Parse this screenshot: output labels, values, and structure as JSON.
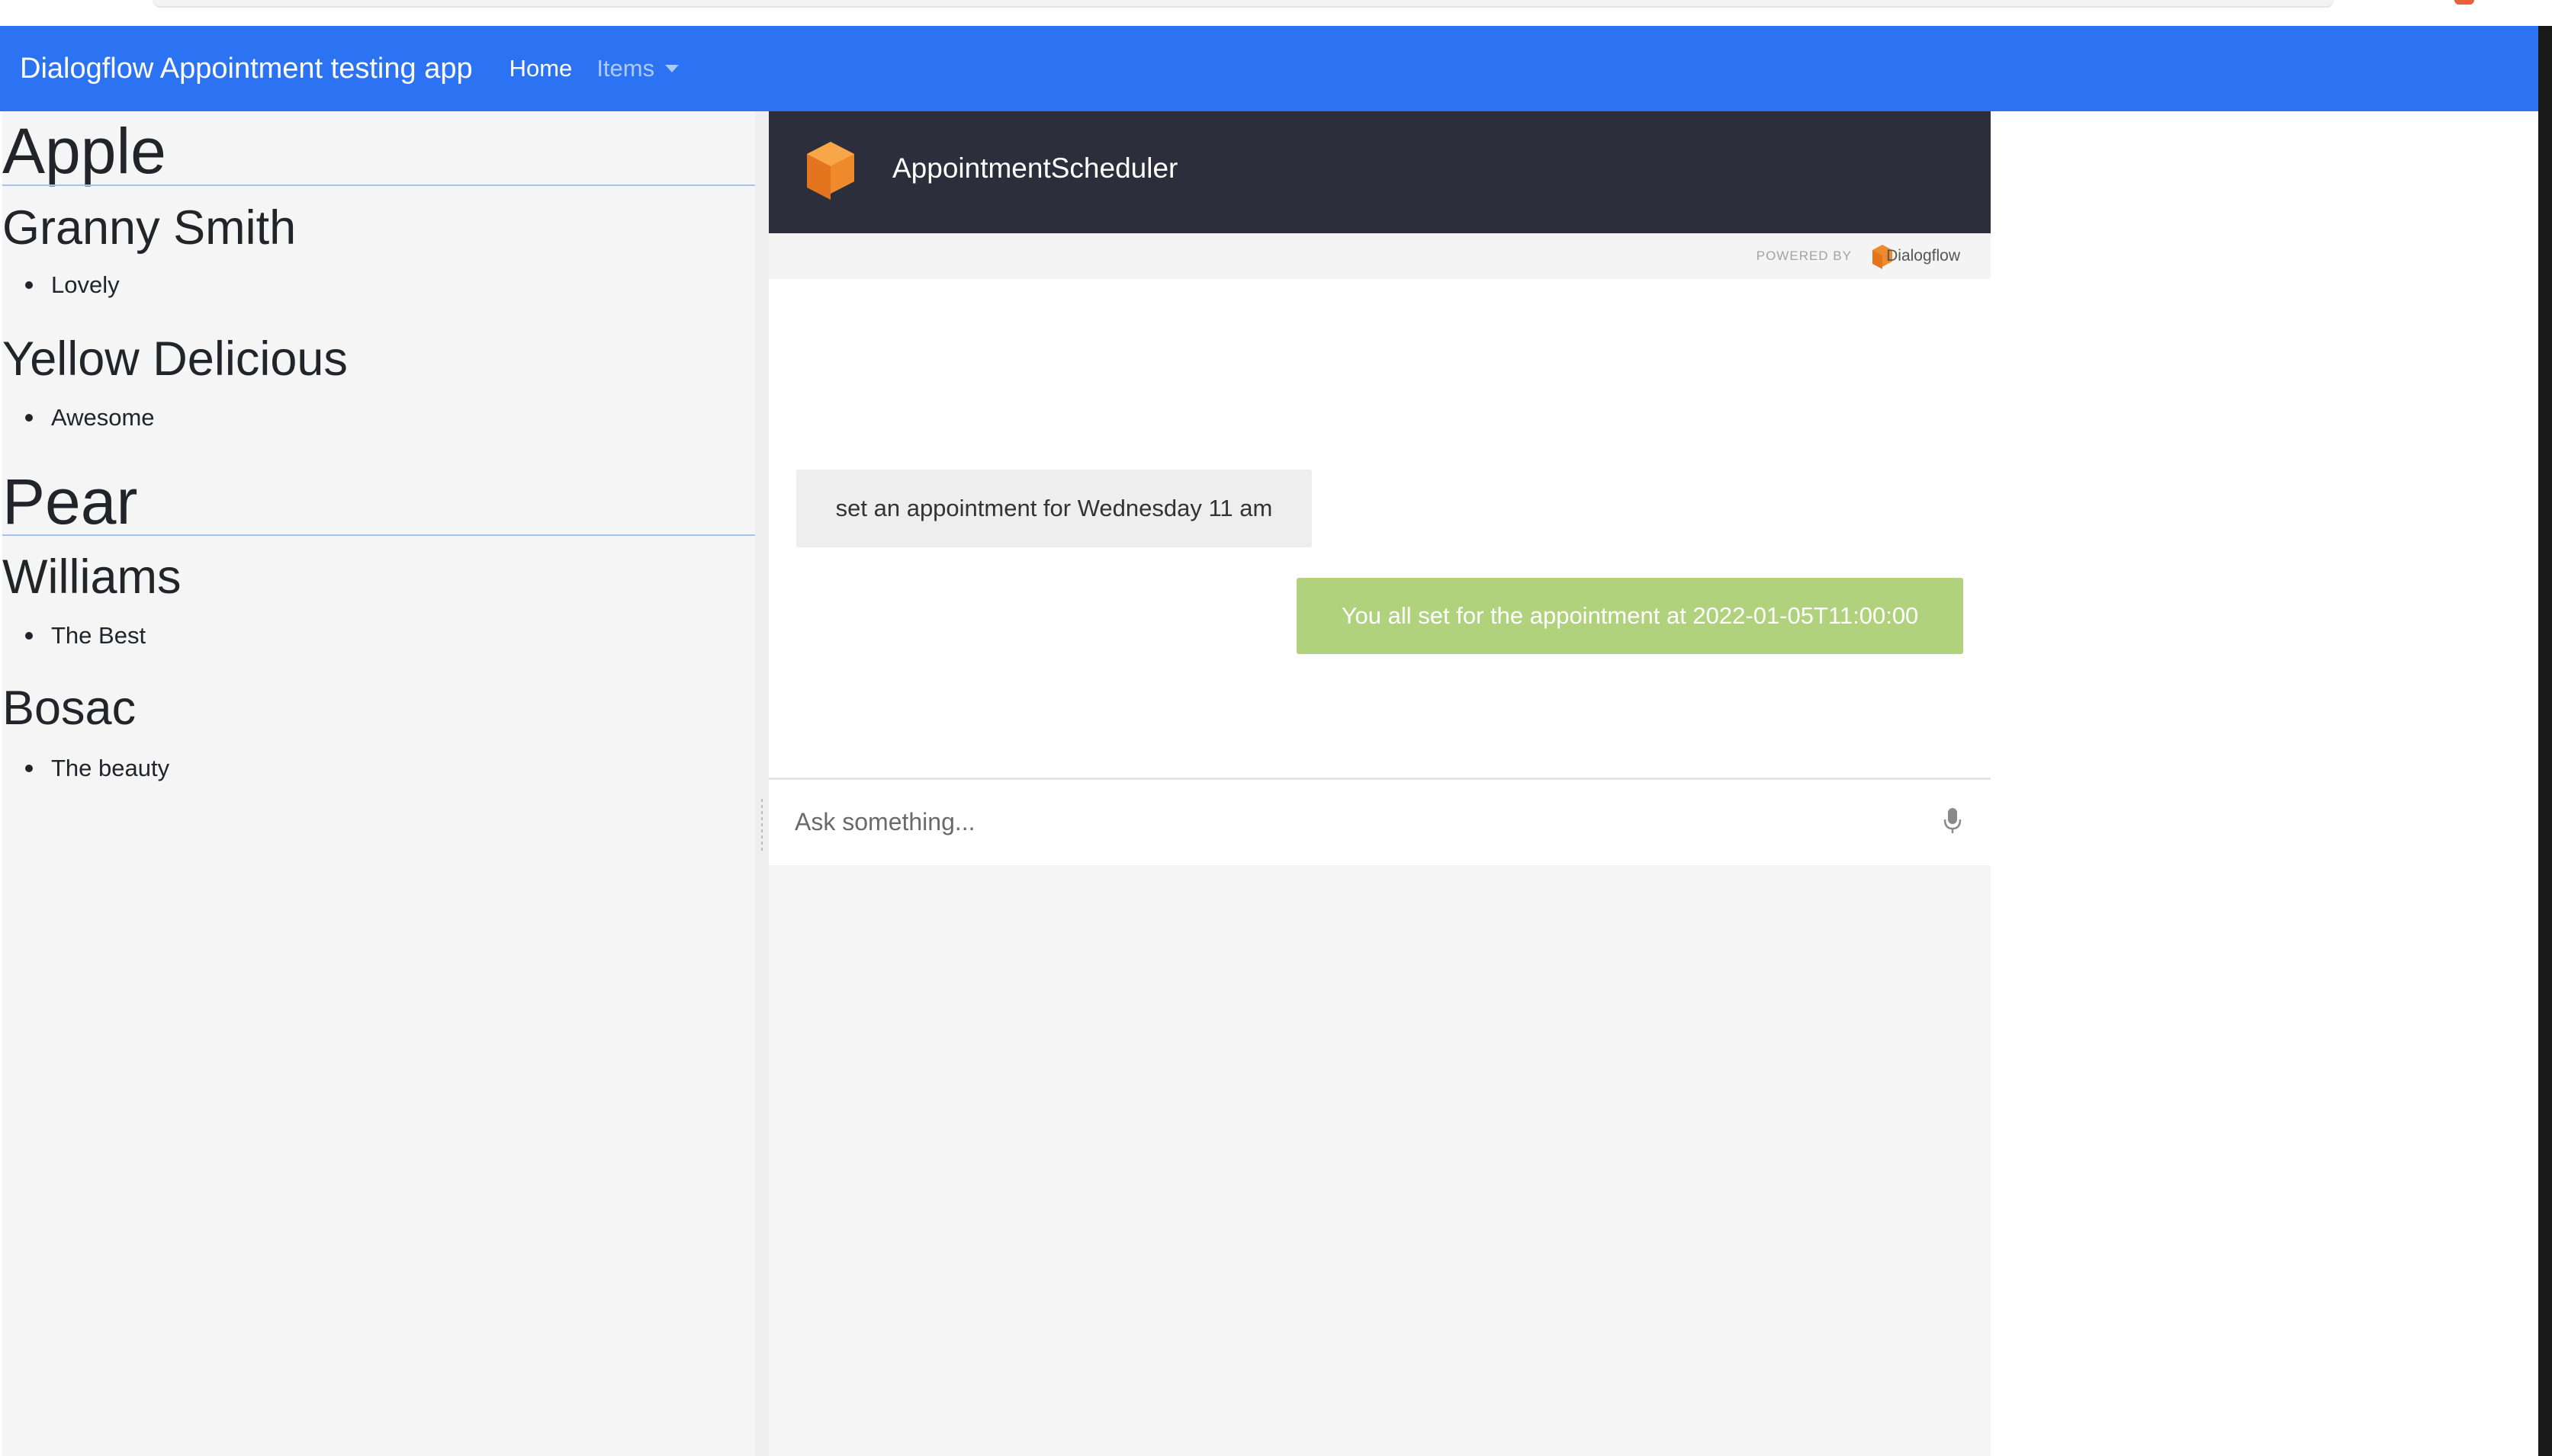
{
  "navbar": {
    "brand": "Dialogflow Appointment testing app",
    "home": "Home",
    "items": "Items"
  },
  "fruits": [
    {
      "name": "Apple",
      "varieties": [
        {
          "name": "Granny Smith",
          "note": "Lovely"
        },
        {
          "name": "Yellow Delicious",
          "note": "Awesome"
        }
      ]
    },
    {
      "name": "Pear",
      "varieties": [
        {
          "name": "Williams",
          "note": "The Best"
        },
        {
          "name": "Bosac",
          "note": "The beauty"
        }
      ]
    }
  ],
  "chat": {
    "agent_name": "AppointmentScheduler",
    "powered_by": "POWERED BY",
    "provider": "Dialogflow",
    "messages": [
      {
        "from": "user",
        "text": "set an appointment for Wednesday 11 am"
      },
      {
        "from": "agent",
        "text": "You all set for the appointment at 2022-01-05T11:00:00"
      }
    ],
    "input_placeholder": "Ask something...",
    "input_value": ""
  },
  "colors": {
    "navbar": "#2b73f3",
    "chat_header": "#2c2f3b",
    "agent_bubble": "#b1d27d",
    "user_bubble": "#eeeeee",
    "dialogflow_orange": "#ef8a2c"
  },
  "icons": {
    "agent": "dialogflow-cube-icon",
    "provider": "dialogflow-logo-icon",
    "microphone": "microphone-icon",
    "dropdown": "caret-down-icon"
  }
}
